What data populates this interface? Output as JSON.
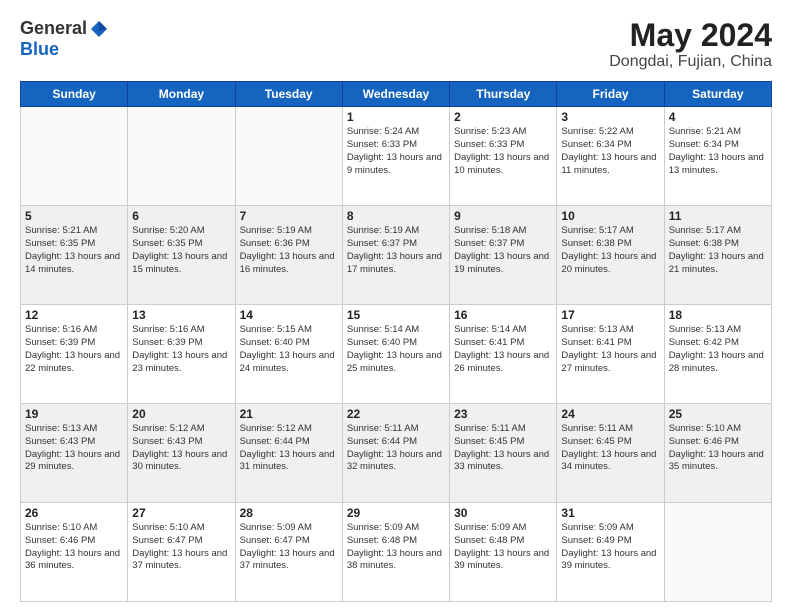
{
  "header": {
    "logo_general": "General",
    "logo_blue": "Blue",
    "title": "May 2024",
    "subtitle": "Dongdai, Fujian, China"
  },
  "days_of_week": [
    "Sunday",
    "Monday",
    "Tuesday",
    "Wednesday",
    "Thursday",
    "Friday",
    "Saturday"
  ],
  "weeks": [
    [
      {
        "day": "",
        "sunrise": "",
        "sunset": "",
        "daylight": "",
        "empty": true
      },
      {
        "day": "",
        "sunrise": "",
        "sunset": "",
        "daylight": "",
        "empty": true
      },
      {
        "day": "",
        "sunrise": "",
        "sunset": "",
        "daylight": "",
        "empty": true
      },
      {
        "day": "1",
        "sunrise": "Sunrise: 5:24 AM",
        "sunset": "Sunset: 6:33 PM",
        "daylight": "Daylight: 13 hours and 9 minutes."
      },
      {
        "day": "2",
        "sunrise": "Sunrise: 5:23 AM",
        "sunset": "Sunset: 6:33 PM",
        "daylight": "Daylight: 13 hours and 10 minutes."
      },
      {
        "day": "3",
        "sunrise": "Sunrise: 5:22 AM",
        "sunset": "Sunset: 6:34 PM",
        "daylight": "Daylight: 13 hours and 11 minutes."
      },
      {
        "day": "4",
        "sunrise": "Sunrise: 5:21 AM",
        "sunset": "Sunset: 6:34 PM",
        "daylight": "Daylight: 13 hours and 13 minutes."
      }
    ],
    [
      {
        "day": "5",
        "sunrise": "Sunrise: 5:21 AM",
        "sunset": "Sunset: 6:35 PM",
        "daylight": "Daylight: 13 hours and 14 minutes."
      },
      {
        "day": "6",
        "sunrise": "Sunrise: 5:20 AM",
        "sunset": "Sunset: 6:35 PM",
        "daylight": "Daylight: 13 hours and 15 minutes."
      },
      {
        "day": "7",
        "sunrise": "Sunrise: 5:19 AM",
        "sunset": "Sunset: 6:36 PM",
        "daylight": "Daylight: 13 hours and 16 minutes."
      },
      {
        "day": "8",
        "sunrise": "Sunrise: 5:19 AM",
        "sunset": "Sunset: 6:37 PM",
        "daylight": "Daylight: 13 hours and 17 minutes."
      },
      {
        "day": "9",
        "sunrise": "Sunrise: 5:18 AM",
        "sunset": "Sunset: 6:37 PM",
        "daylight": "Daylight: 13 hours and 19 minutes."
      },
      {
        "day": "10",
        "sunrise": "Sunrise: 5:17 AM",
        "sunset": "Sunset: 6:38 PM",
        "daylight": "Daylight: 13 hours and 20 minutes."
      },
      {
        "day": "11",
        "sunrise": "Sunrise: 5:17 AM",
        "sunset": "Sunset: 6:38 PM",
        "daylight": "Daylight: 13 hours and 21 minutes."
      }
    ],
    [
      {
        "day": "12",
        "sunrise": "Sunrise: 5:16 AM",
        "sunset": "Sunset: 6:39 PM",
        "daylight": "Daylight: 13 hours and 22 minutes."
      },
      {
        "day": "13",
        "sunrise": "Sunrise: 5:16 AM",
        "sunset": "Sunset: 6:39 PM",
        "daylight": "Daylight: 13 hours and 23 minutes."
      },
      {
        "day": "14",
        "sunrise": "Sunrise: 5:15 AM",
        "sunset": "Sunset: 6:40 PM",
        "daylight": "Daylight: 13 hours and 24 minutes."
      },
      {
        "day": "15",
        "sunrise": "Sunrise: 5:14 AM",
        "sunset": "Sunset: 6:40 PM",
        "daylight": "Daylight: 13 hours and 25 minutes."
      },
      {
        "day": "16",
        "sunrise": "Sunrise: 5:14 AM",
        "sunset": "Sunset: 6:41 PM",
        "daylight": "Daylight: 13 hours and 26 minutes."
      },
      {
        "day": "17",
        "sunrise": "Sunrise: 5:13 AM",
        "sunset": "Sunset: 6:41 PM",
        "daylight": "Daylight: 13 hours and 27 minutes."
      },
      {
        "day": "18",
        "sunrise": "Sunrise: 5:13 AM",
        "sunset": "Sunset: 6:42 PM",
        "daylight": "Daylight: 13 hours and 28 minutes."
      }
    ],
    [
      {
        "day": "19",
        "sunrise": "Sunrise: 5:13 AM",
        "sunset": "Sunset: 6:43 PM",
        "daylight": "Daylight: 13 hours and 29 minutes."
      },
      {
        "day": "20",
        "sunrise": "Sunrise: 5:12 AM",
        "sunset": "Sunset: 6:43 PM",
        "daylight": "Daylight: 13 hours and 30 minutes."
      },
      {
        "day": "21",
        "sunrise": "Sunrise: 5:12 AM",
        "sunset": "Sunset: 6:44 PM",
        "daylight": "Daylight: 13 hours and 31 minutes."
      },
      {
        "day": "22",
        "sunrise": "Sunrise: 5:11 AM",
        "sunset": "Sunset: 6:44 PM",
        "daylight": "Daylight: 13 hours and 32 minutes."
      },
      {
        "day": "23",
        "sunrise": "Sunrise: 5:11 AM",
        "sunset": "Sunset: 6:45 PM",
        "daylight": "Daylight: 13 hours and 33 minutes."
      },
      {
        "day": "24",
        "sunrise": "Sunrise: 5:11 AM",
        "sunset": "Sunset: 6:45 PM",
        "daylight": "Daylight: 13 hours and 34 minutes."
      },
      {
        "day": "25",
        "sunrise": "Sunrise: 5:10 AM",
        "sunset": "Sunset: 6:46 PM",
        "daylight": "Daylight: 13 hours and 35 minutes."
      }
    ],
    [
      {
        "day": "26",
        "sunrise": "Sunrise: 5:10 AM",
        "sunset": "Sunset: 6:46 PM",
        "daylight": "Daylight: 13 hours and 36 minutes."
      },
      {
        "day": "27",
        "sunrise": "Sunrise: 5:10 AM",
        "sunset": "Sunset: 6:47 PM",
        "daylight": "Daylight: 13 hours and 37 minutes."
      },
      {
        "day": "28",
        "sunrise": "Sunrise: 5:09 AM",
        "sunset": "Sunset: 6:47 PM",
        "daylight": "Daylight: 13 hours and 37 minutes."
      },
      {
        "day": "29",
        "sunrise": "Sunrise: 5:09 AM",
        "sunset": "Sunset: 6:48 PM",
        "daylight": "Daylight: 13 hours and 38 minutes."
      },
      {
        "day": "30",
        "sunrise": "Sunrise: 5:09 AM",
        "sunset": "Sunset: 6:48 PM",
        "daylight": "Daylight: 13 hours and 39 minutes."
      },
      {
        "day": "31",
        "sunrise": "Sunrise: 5:09 AM",
        "sunset": "Sunset: 6:49 PM",
        "daylight": "Daylight: 13 hours and 39 minutes."
      },
      {
        "day": "",
        "sunrise": "",
        "sunset": "",
        "daylight": "",
        "empty": true
      }
    ]
  ]
}
